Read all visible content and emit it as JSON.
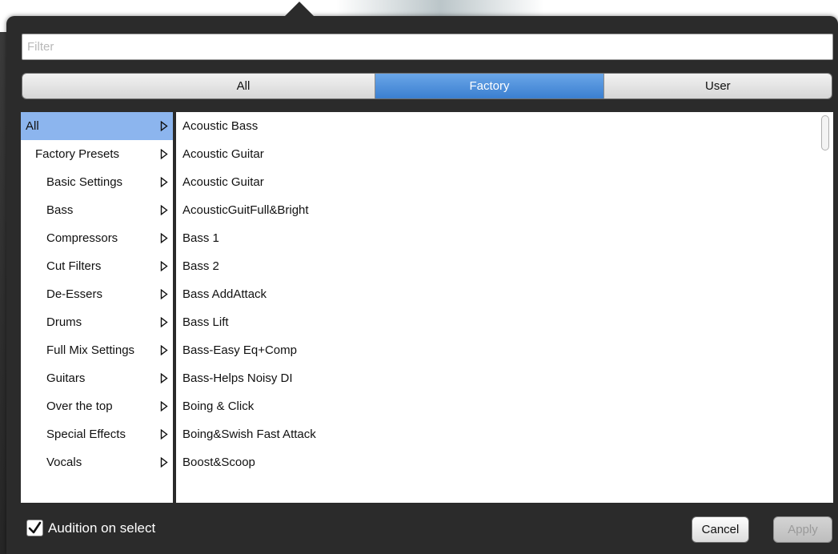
{
  "filter": {
    "placeholder": "Filter",
    "value": ""
  },
  "tabs": [
    {
      "label": "All",
      "selected": false
    },
    {
      "label": "Factory",
      "selected": true
    },
    {
      "label": "User",
      "selected": false
    }
  ],
  "categories": [
    {
      "label": "All",
      "selected": true
    },
    {
      "label": "Factory Presets"
    },
    {
      "label": "Basic Settings"
    },
    {
      "label": "Bass"
    },
    {
      "label": "Compressors"
    },
    {
      "label": "Cut Filters"
    },
    {
      "label": "De-Essers"
    },
    {
      "label": "Drums"
    },
    {
      "label": "Full Mix Settings"
    },
    {
      "label": "Guitars"
    },
    {
      "label": "Over the top"
    },
    {
      "label": "Special Effects"
    },
    {
      "label": "Vocals"
    }
  ],
  "presets": [
    "Acoustic Bass",
    "Acoustic Guitar",
    "Acoustic Guitar",
    "AcousticGuitFull&Bright",
    "Bass 1",
    "Bass 2",
    "Bass AddAttack",
    "Bass Lift",
    "Bass-Easy Eq+Comp",
    "Bass-Helps Noisy DI",
    "Boing & Click",
    "Boing&Swish Fast Attack",
    "Boost&Scoop"
  ],
  "footer": {
    "audition_label": "Audition on select",
    "audition_checked": true,
    "cancel_label": "Cancel",
    "apply_label": "Apply"
  },
  "colors": {
    "accent": "#3b7fd0",
    "selection": "#8cb5ee",
    "popover_bg": "#2b2b2b"
  }
}
